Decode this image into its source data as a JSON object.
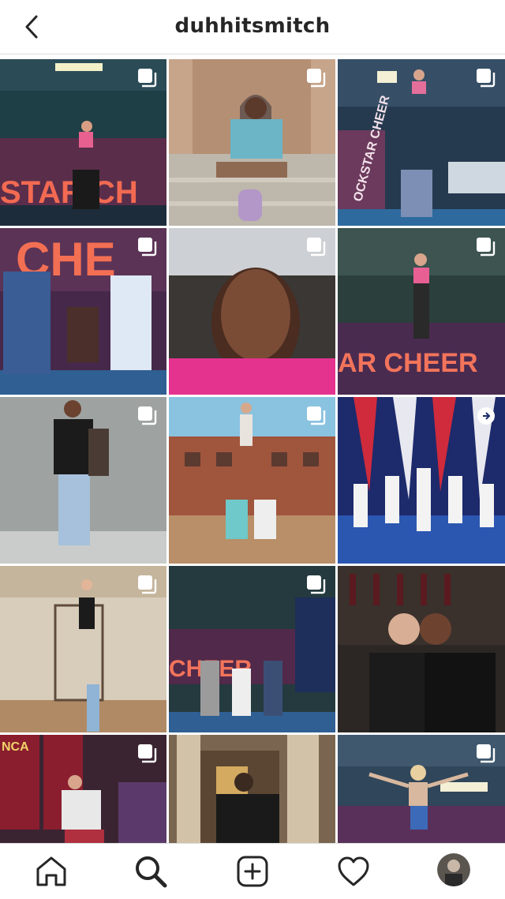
{
  "header": {
    "username": "duhhitsmitch",
    "back_icon": "chevron-left-icon"
  },
  "grid": {
    "tiles": [
      {
        "name": "post-cheer-stunt-gym",
        "badge": "carousel-icon",
        "caption": "STAR CH"
      },
      {
        "name": "post-sitting-steps",
        "badge": "carousel-icon",
        "caption": ""
      },
      {
        "name": "post-stunt-pyramid-gym",
        "badge": "carousel-icon",
        "caption": "OCKSTAR CHEER"
      },
      {
        "name": "post-three-people-gym",
        "badge": "carousel-icon",
        "caption": "CHE"
      },
      {
        "name": "post-selfie-car",
        "badge": "carousel-icon",
        "caption": ""
      },
      {
        "name": "post-heel-stretch-stunt",
        "badge": "carousel-icon",
        "caption": "AR CHEER"
      },
      {
        "name": "post-standing-wall",
        "badge": "carousel-icon",
        "caption": ""
      },
      {
        "name": "post-stunt-outdoor",
        "badge": "carousel-icon",
        "caption": ""
      },
      {
        "name": "post-cheer-team-stage",
        "badge": "reel-icon",
        "caption": ""
      },
      {
        "name": "post-stunt-gym-basketball",
        "badge": "carousel-icon",
        "caption": ""
      },
      {
        "name": "post-team-gym",
        "badge": "carousel-icon",
        "caption": "CHEER"
      },
      {
        "name": "post-wine-kiss",
        "badge": "",
        "caption": ""
      },
      {
        "name": "post-nca-banners",
        "badge": "carousel-icon",
        "caption": "NCA"
      },
      {
        "name": "post-hotel-lobby",
        "badge": "",
        "caption": ""
      },
      {
        "name": "post-flyer-gym",
        "badge": "carousel-icon",
        "caption": ""
      }
    ]
  },
  "tabbar": {
    "items": [
      "home-icon",
      "search-icon",
      "add-post-icon",
      "heart-icon",
      "profile-avatar"
    ]
  },
  "colors": {
    "border": "#dbdbdb",
    "text": "#262626"
  }
}
